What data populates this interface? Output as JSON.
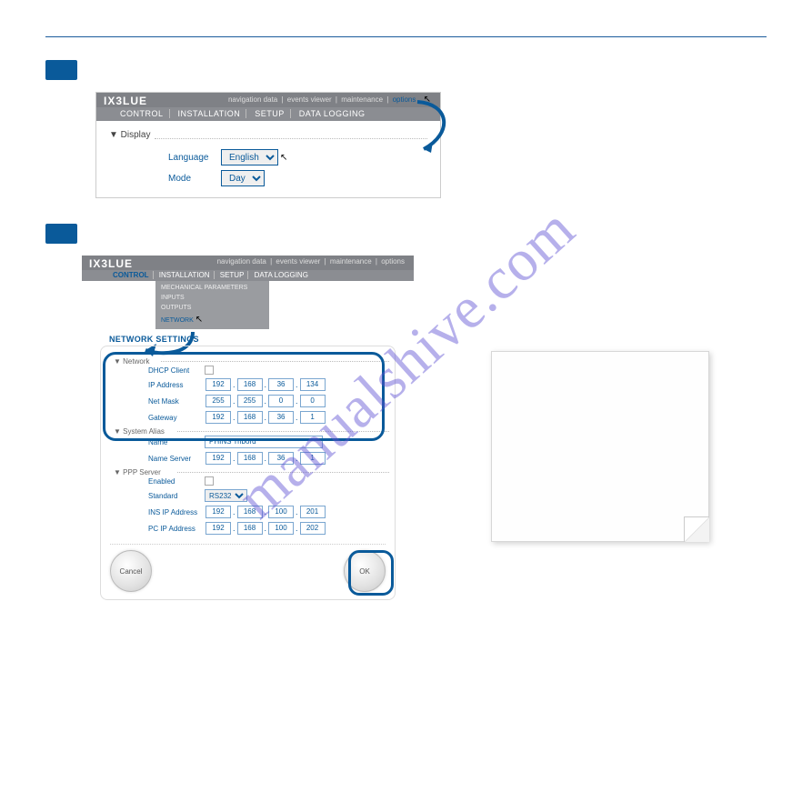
{
  "watermark": "manualshive.com",
  "shot1": {
    "logo": "IX3LUE",
    "toplinks": [
      "navigation data",
      "events viewer",
      "maintenance",
      "options"
    ],
    "menu": [
      "CONTROL",
      "INSTALLATION",
      "SETUP",
      "DATA LOGGING"
    ],
    "panel_title": "▼ Display",
    "language_label": "Language",
    "language_value": "English",
    "mode_label": "Mode",
    "mode_value": "Day"
  },
  "shot2": {
    "logo": "IX3LUE",
    "toplinks": [
      "navigation data",
      "events viewer",
      "maintenance",
      "options"
    ],
    "menu": [
      "CONTROL",
      "INSTALLATION",
      "SETUP",
      "DATA LOGGING"
    ],
    "submenu": [
      "MECHANICAL PARAMETERS",
      "INPUTS",
      "OUTPUTS",
      "NETWORK"
    ],
    "section": "NETWORK SETTINGS",
    "grp_network": "▼  Network",
    "dhcp_label": "DHCP Client",
    "ip_label": "IP Address",
    "ip": [
      "192",
      "168",
      "36",
      "134"
    ],
    "mask_label": "Net Mask",
    "mask": [
      "255",
      "255",
      "0",
      "0"
    ],
    "gw_label": "Gateway",
    "gw": [
      "192",
      "168",
      "36",
      "1"
    ],
    "grp_alias": "▼  System Alias",
    "name_label": "Name",
    "name_value": "PHINS Tribord",
    "ns_label": "Name Server",
    "ns": [
      "192",
      "168",
      "36",
      "1"
    ],
    "grp_ppp": "▼  PPP Server",
    "enabled_label": "Enabled",
    "standard_label": "Standard",
    "standard_value": "RS232",
    "insip_label": "INS IP Address",
    "insip": [
      "192",
      "168",
      "100",
      "201"
    ],
    "pcip_label": "PC IP Address",
    "pcip": [
      "192",
      "168",
      "100",
      "202"
    ],
    "cancel": "Cancel",
    "ok": "OK"
  }
}
